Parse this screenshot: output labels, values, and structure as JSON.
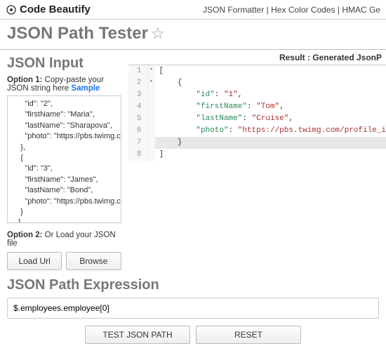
{
  "topbar": {
    "logo_text": "Code Beautify",
    "links": [
      "JSON Formatter",
      "Hex Color Codes",
      "HMAC Ge"
    ]
  },
  "page_title": "JSON Path Tester",
  "input_section": {
    "title": "JSON Input",
    "option1_prefix": "Option 1:",
    "option1_text": " Copy-paste your JSON string here ",
    "sample_label": "Sample",
    "textarea_value": "      \"id\": \"2\",\n      \"firstName\": \"Maria\",\n      \"lastName\": \"Sharapova\",\n      \"photo\": \"https://pbs.twimg.com/profile_images/\n    },\n    {\n      \"id\": \"3\",\n      \"firstName\": \"James\",\n      \"lastName\": \"Bond\",\n      \"photo\": \"https://pbs.twimg.com/profile_images/\n    }\n   ]\n  }\n}",
    "option2_prefix": "Option 2:",
    "option2_text": " Or Load your JSON file",
    "load_url_label": "Load Url",
    "browse_label": "Browse"
  },
  "result": {
    "header": "Result : Generated JsonP",
    "lines": [
      {
        "n": "1",
        "fold": "▾",
        "code": [
          {
            "t": "[",
            "c": "punc"
          }
        ]
      },
      {
        "n": "2",
        "fold": "▾",
        "code": [
          {
            "t": "    {",
            "c": "punc"
          }
        ]
      },
      {
        "n": "3",
        "fold": "",
        "code": [
          {
            "t": "        ",
            "c": "punc"
          },
          {
            "t": "\"id\"",
            "c": "kstr"
          },
          {
            "t": ": ",
            "c": "punc"
          },
          {
            "t": "\"1\"",
            "c": "vstr"
          },
          {
            "t": ",",
            "c": "punc"
          }
        ]
      },
      {
        "n": "4",
        "fold": "",
        "code": [
          {
            "t": "        ",
            "c": "punc"
          },
          {
            "t": "\"firstName\"",
            "c": "kstr"
          },
          {
            "t": ": ",
            "c": "punc"
          },
          {
            "t": "\"Tom\"",
            "c": "vstr"
          },
          {
            "t": ",",
            "c": "punc"
          }
        ]
      },
      {
        "n": "5",
        "fold": "",
        "code": [
          {
            "t": "        ",
            "c": "punc"
          },
          {
            "t": "\"lastName\"",
            "c": "kstr"
          },
          {
            "t": ": ",
            "c": "punc"
          },
          {
            "t": "\"Cruise\"",
            "c": "vstr"
          },
          {
            "t": ",",
            "c": "punc"
          }
        ]
      },
      {
        "n": "6",
        "fold": "",
        "code": [
          {
            "t": "        ",
            "c": "punc"
          },
          {
            "t": "\"photo\"",
            "c": "kstr"
          },
          {
            "t": ": ",
            "c": "punc"
          },
          {
            "t": "\"https://pbs.twimg.com/profile_i",
            "c": "vstr"
          }
        ]
      },
      {
        "n": "7",
        "fold": "",
        "hl": true,
        "code": [
          {
            "t": "    }",
            "c": "punc"
          }
        ]
      },
      {
        "n": "8",
        "fold": "",
        "code": [
          {
            "t": "]",
            "c": "punc"
          }
        ]
      }
    ]
  },
  "path_section": {
    "title": "JSON Path Expression",
    "value": "$.employees.employee[0]",
    "test_label": "TEST JSON PATH",
    "reset_label": "RESET"
  }
}
